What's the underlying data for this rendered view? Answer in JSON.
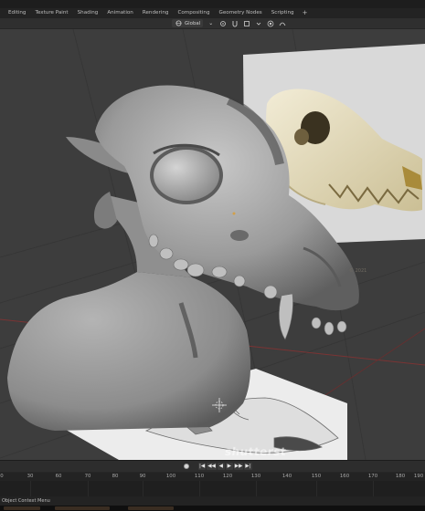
{
  "workspace_tabs": [
    "Editing",
    "Texture Paint",
    "Shading",
    "Animation",
    "Rendering",
    "Compositing",
    "Geometry Nodes",
    "Scripting"
  ],
  "add_tab_symbol": "+",
  "header": {
    "transform_orientation": "Global",
    "dropdown_symbol": "⌄"
  },
  "viewport": {
    "reference_credit": "© 2021",
    "watermark": "shutterst"
  },
  "timeline": {
    "transport": [
      "|◀",
      "◀◀",
      "◀",
      "▶",
      "▶▶",
      "▶|"
    ],
    "frame_ticks": [
      "0",
      "30",
      "60",
      "70",
      "80",
      "90",
      "100",
      "110",
      "120",
      "130",
      "140",
      "150",
      "160",
      "170",
      "180",
      "190"
    ]
  },
  "status_bar": {
    "left_text": "Object Context Menu"
  },
  "colors": {
    "viewport_bg": "#3d3d3d",
    "sculpt_gray": "#9a9a9a",
    "bone_ivory": "#e4dcc0",
    "grid_red": "#8a3a3a"
  }
}
